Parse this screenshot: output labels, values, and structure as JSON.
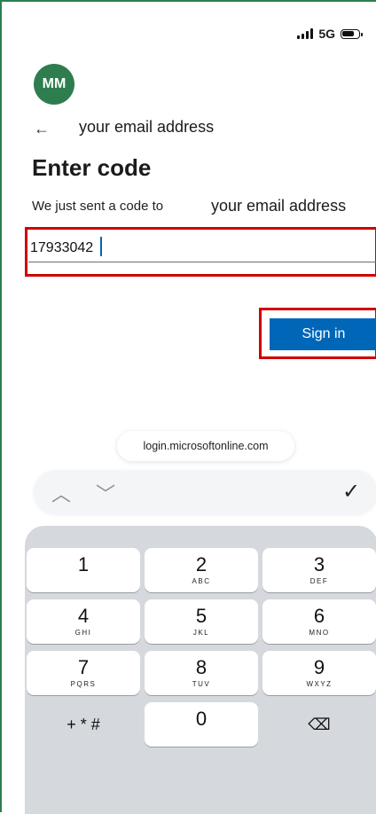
{
  "status_bar": {
    "network": "5G"
  },
  "account": {
    "avatar_initials": "MM",
    "email": "your email address"
  },
  "page": {
    "back_glyph": "←",
    "title": "Enter code",
    "sent_prefix": "We just sent a code to",
    "sent_email": "your email address"
  },
  "code_input": {
    "value": "17933042"
  },
  "signin_button": {
    "label": "Sign in"
  },
  "browser": {
    "url": "login.microsoftonline.com"
  },
  "accessory": {
    "up_glyph": "︿",
    "down_glyph": "﹀",
    "done_glyph": "✓"
  },
  "keypad": {
    "k1": {
      "num": "1",
      "letters": ""
    },
    "k2": {
      "num": "2",
      "letters": "ABC"
    },
    "k3": {
      "num": "3",
      "letters": "DEF"
    },
    "k4": {
      "num": "4",
      "letters": "GHI"
    },
    "k5": {
      "num": "5",
      "letters": "JKL"
    },
    "k6": {
      "num": "6",
      "letters": "MNO"
    },
    "k7": {
      "num": "7",
      "letters": "PQRS"
    },
    "k8": {
      "num": "8",
      "letters": "TUV"
    },
    "k9": {
      "num": "9",
      "letters": "WXYZ"
    },
    "symbols": "+ * #",
    "k0": {
      "num": "0"
    },
    "backspace_glyph": "⌫"
  },
  "colors": {
    "accent": "#0067b8",
    "avatar": "#2e7d4f",
    "highlight": "#d00000"
  }
}
